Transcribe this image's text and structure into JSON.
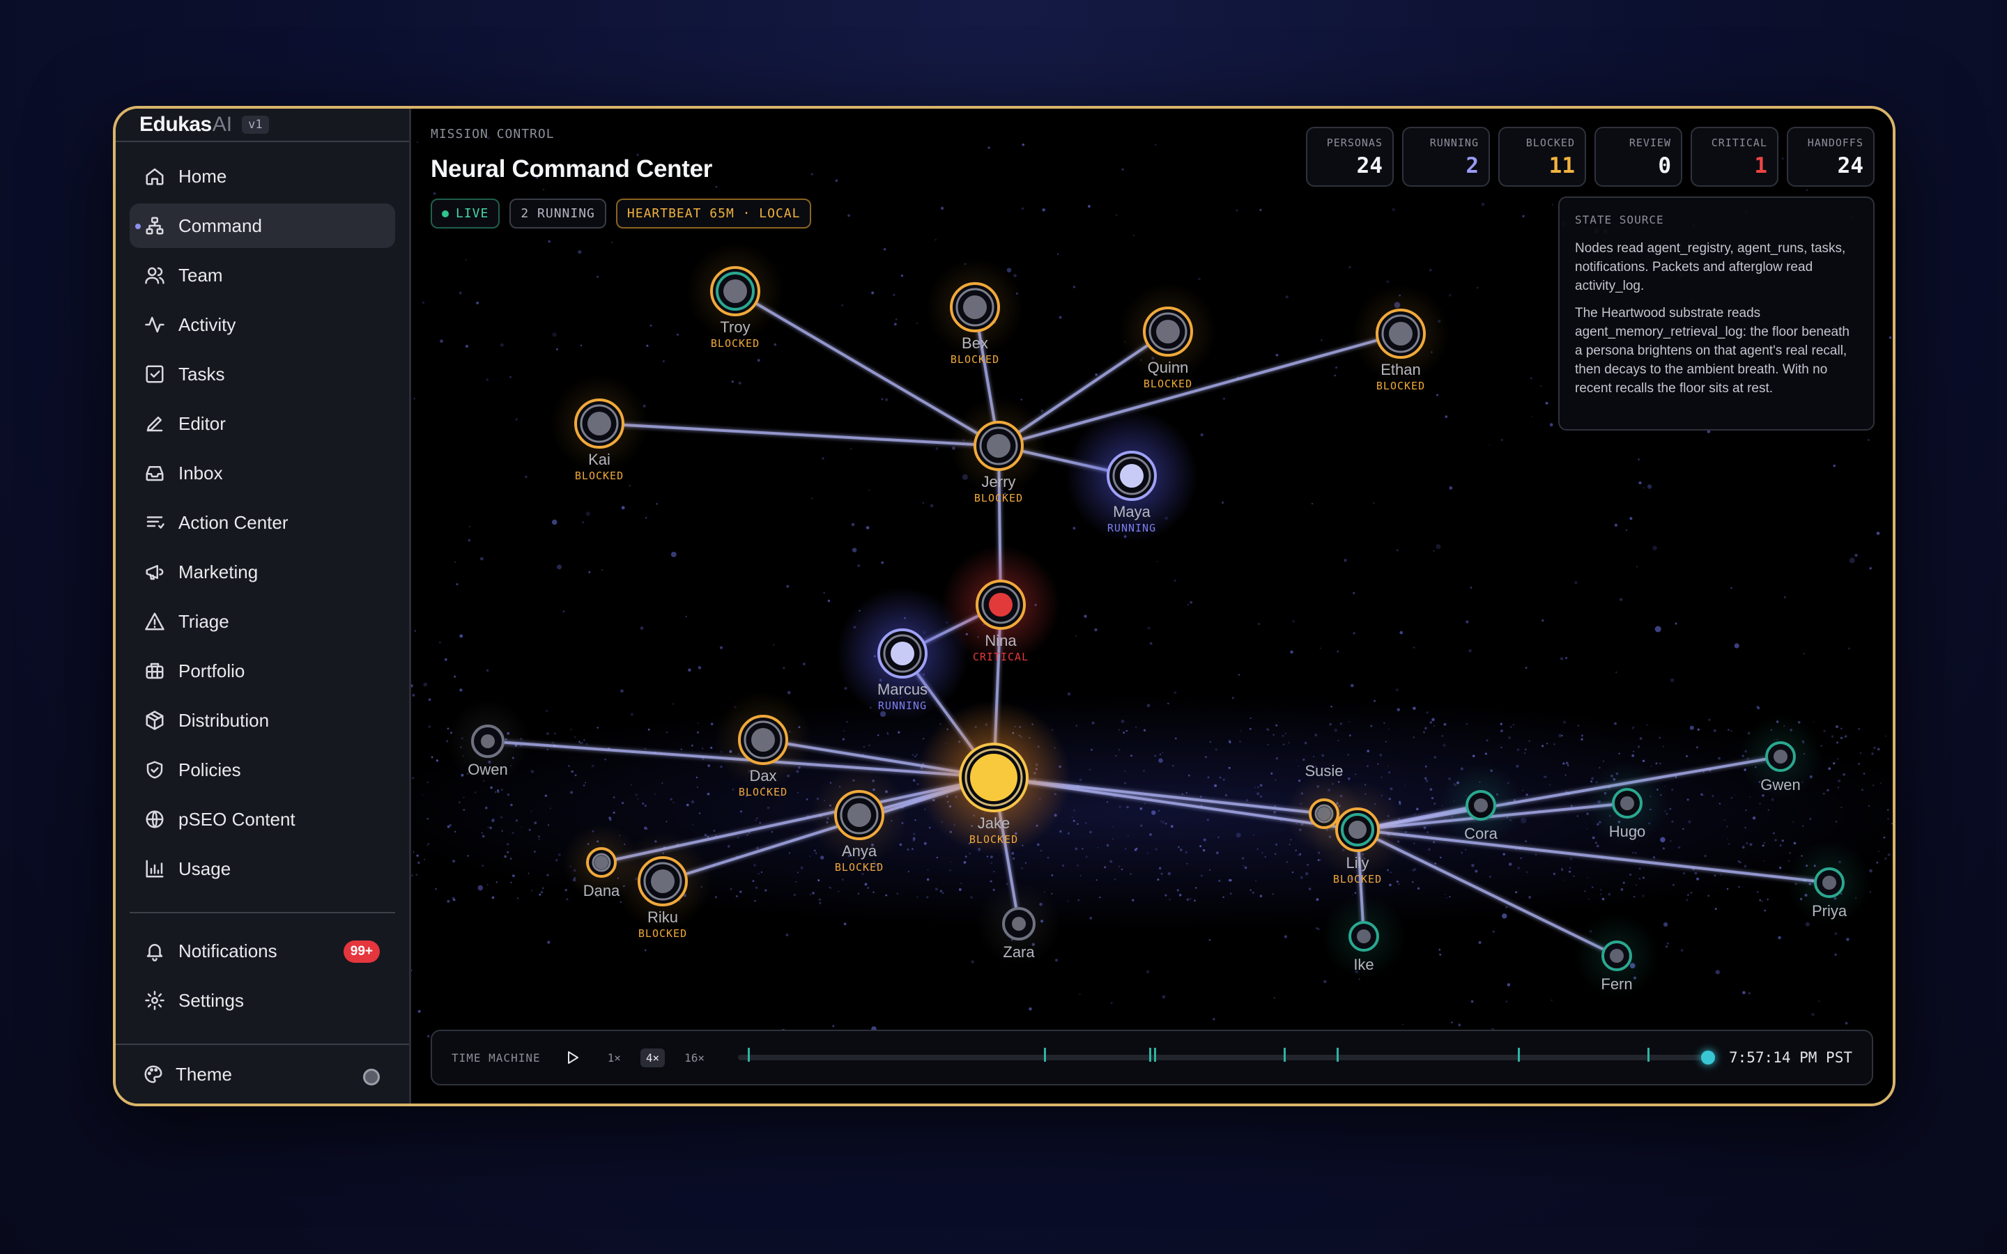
{
  "brand": {
    "name": "Edukas",
    "suffix": "AI",
    "version": "v1"
  },
  "nav": [
    {
      "label": "Home",
      "icon": "home-icon"
    },
    {
      "label": "Command",
      "icon": "network-icon",
      "active": true
    },
    {
      "label": "Team",
      "icon": "users-icon"
    },
    {
      "label": "Activity",
      "icon": "activity-icon"
    },
    {
      "label": "Tasks",
      "icon": "checkbox-icon"
    },
    {
      "label": "Editor",
      "icon": "pen-icon"
    },
    {
      "label": "Inbox",
      "icon": "inbox-icon"
    },
    {
      "label": "Action Center",
      "icon": "list-icon"
    },
    {
      "label": "Marketing",
      "icon": "megaphone-icon"
    },
    {
      "label": "Triage",
      "icon": "warning-icon"
    },
    {
      "label": "Portfolio",
      "icon": "briefcase-icon"
    },
    {
      "label": "Distribution",
      "icon": "package-icon"
    },
    {
      "label": "Policies",
      "icon": "shield-icon"
    },
    {
      "label": "pSEO Content",
      "icon": "globe-icon"
    },
    {
      "label": "Usage",
      "icon": "bar-chart-icon"
    }
  ],
  "nav_bottom": [
    {
      "label": "Notifications",
      "icon": "bell-icon",
      "badge": "99+"
    },
    {
      "label": "Settings",
      "icon": "gear-icon"
    }
  ],
  "theme": {
    "label": "Theme"
  },
  "header": {
    "eyebrow": "MISSION CONTROL",
    "title": "Neural Command Center",
    "pills": {
      "live": "LIVE",
      "running": "2 RUNNING",
      "heartbeat": "HEARTBEAT 65M · LOCAL"
    }
  },
  "stats": [
    {
      "label": "PERSONAS",
      "value": "24",
      "color": "#f3f4f7"
    },
    {
      "label": "RUNNING",
      "value": "2",
      "color": "#9a9cf4"
    },
    {
      "label": "BLOCKED",
      "value": "11",
      "color": "#f1b33e"
    },
    {
      "label": "REVIEW",
      "value": "0",
      "color": "#f3f4f7"
    },
    {
      "label": "CRITICAL",
      "value": "1",
      "color": "#ef4444"
    },
    {
      "label": "HANDOFFS",
      "value": "24",
      "color": "#f3f4f7"
    }
  ],
  "state_source": {
    "title": "STATE SOURCE",
    "p1": "Nodes read agent_registry, agent_runs, tasks, notifications. Packets and afterglow read activity_log.",
    "p2": "The Heartwood substrate reads agent_memory_retrieval_log: the floor beneath a persona brightens on that agent's real recall, then decays to the ambient breath. With no recent recalls the floor sits at rest."
  },
  "colors": {
    "blocked": "#f1a93a",
    "running": "#7c7ff0",
    "critical": "#e23a3a",
    "idle": "#8a8d98",
    "teal": "#2aa890",
    "edge": "#aeb2f2"
  },
  "nodes": [
    {
      "id": "troy",
      "name": "Troy",
      "status": "BLOCKED",
      "ring": "blocked",
      "inner": "teal"
    },
    {
      "id": "bex",
      "name": "Bex",
      "status": "BLOCKED",
      "ring": "blocked"
    },
    {
      "id": "quinn",
      "name": "Quinn",
      "status": "BLOCKED",
      "ring": "blocked"
    },
    {
      "id": "ethan",
      "name": "Ethan",
      "status": "BLOCKED",
      "ring": "blocked"
    },
    {
      "id": "kai",
      "name": "Kai",
      "status": "BLOCKED",
      "ring": "blocked"
    },
    {
      "id": "jerry",
      "name": "Jerry",
      "status": "BLOCKED",
      "ring": "blocked"
    },
    {
      "id": "maya",
      "name": "Maya",
      "status": "RUNNING",
      "ring": "running"
    },
    {
      "id": "nina",
      "name": "Nina",
      "status": "CRITICAL",
      "ring": "critical"
    },
    {
      "id": "marcus",
      "name": "Marcus",
      "status": "RUNNING",
      "ring": "running"
    },
    {
      "id": "owen",
      "name": "Owen",
      "status": "",
      "ring": "idle"
    },
    {
      "id": "dax",
      "name": "Dax",
      "status": "BLOCKED",
      "ring": "blocked"
    },
    {
      "id": "jake",
      "name": "Jake",
      "status": "BLOCKED",
      "ring": "hub"
    },
    {
      "id": "anya",
      "name": "Anya",
      "status": "BLOCKED",
      "ring": "blocked"
    },
    {
      "id": "dana",
      "name": "Dana",
      "status": "",
      "ring": "blocked-small"
    },
    {
      "id": "riku",
      "name": "Riku",
      "status": "BLOCKED",
      "ring": "blocked"
    },
    {
      "id": "zara",
      "name": "Zara",
      "status": "",
      "ring": "idle"
    },
    {
      "id": "susie",
      "name": "Susie",
      "status": "",
      "ring": "blocked-small"
    },
    {
      "id": "lily",
      "name": "Lily",
      "status": "BLOCKED",
      "ring": "blocked-teal"
    },
    {
      "id": "cora",
      "name": "Cora",
      "status": "",
      "ring": "teal"
    },
    {
      "id": "hugo",
      "name": "Hugo",
      "status": "",
      "ring": "teal"
    },
    {
      "id": "gwen",
      "name": "Gwen",
      "status": "",
      "ring": "teal"
    },
    {
      "id": "priya",
      "name": "Priya",
      "status": "",
      "ring": "teal"
    },
    {
      "id": "ike",
      "name": "Ike",
      "status": "",
      "ring": "teal"
    },
    {
      "id": "fern",
      "name": "Fern",
      "status": "",
      "ring": "teal"
    }
  ],
  "edges": [
    [
      "jerry",
      "troy"
    ],
    [
      "jerry",
      "bex"
    ],
    [
      "jerry",
      "quinn"
    ],
    [
      "jerry",
      "ethan"
    ],
    [
      "jerry",
      "kai"
    ],
    [
      "jerry",
      "maya"
    ],
    [
      "jerry",
      "nina"
    ],
    [
      "nina",
      "marcus"
    ],
    [
      "nina",
      "jake"
    ],
    [
      "marcus",
      "jake"
    ],
    [
      "jake",
      "owen"
    ],
    [
      "jake",
      "dax"
    ],
    [
      "jake",
      "anya"
    ],
    [
      "jake",
      "dana"
    ],
    [
      "jake",
      "riku"
    ],
    [
      "jake",
      "zara"
    ],
    [
      "jake",
      "susie"
    ],
    [
      "jake",
      "lily"
    ],
    [
      "lily",
      "cora"
    ],
    [
      "lily",
      "hugo"
    ],
    [
      "lily",
      "gwen"
    ],
    [
      "lily",
      "priya"
    ],
    [
      "lily",
      "ike"
    ],
    [
      "lily",
      "fern"
    ]
  ],
  "time_machine": {
    "label": "TIME MACHINE",
    "speeds": [
      "1×",
      "4×",
      "16×"
    ],
    "active_speed": "4×",
    "time": "7:57:14 PM PST"
  }
}
